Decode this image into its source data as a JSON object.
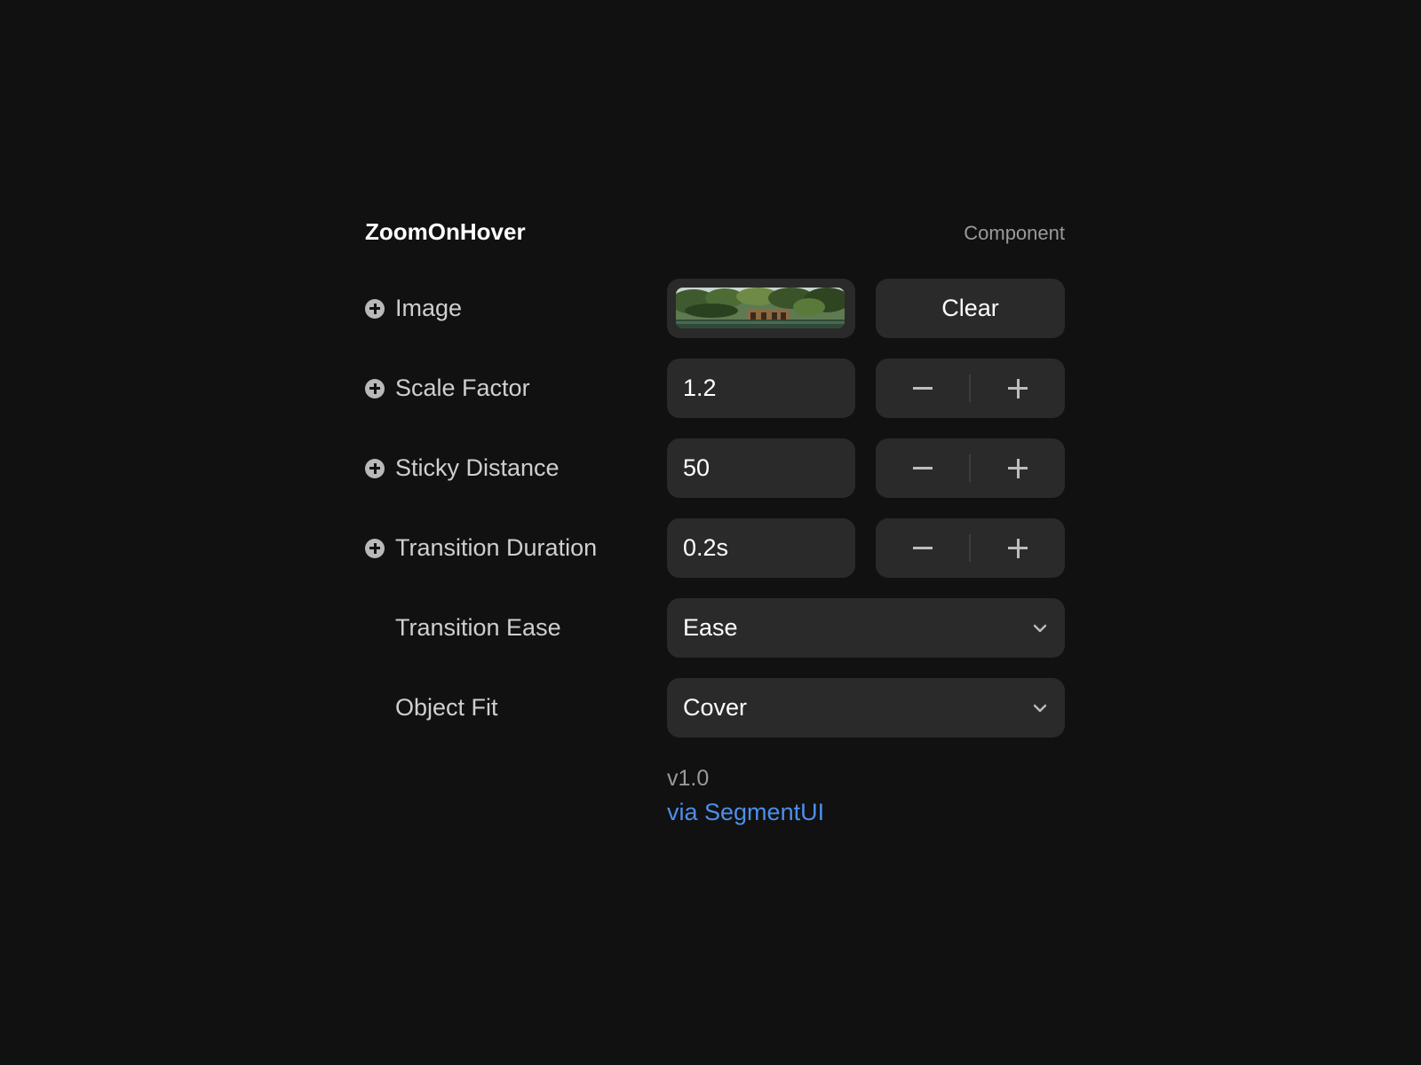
{
  "header": {
    "title": "ZoomOnHover",
    "kind": "Component"
  },
  "properties": {
    "image": {
      "label": "Image",
      "clear_label": "Clear"
    },
    "scale_factor": {
      "label": "Scale Factor",
      "value": "1.2"
    },
    "sticky_distance": {
      "label": "Sticky Distance",
      "value": "50"
    },
    "transition_duration": {
      "label": "Transition Duration",
      "value": "0.2s"
    },
    "transition_ease": {
      "label": "Transition Ease",
      "value": "Ease"
    },
    "object_fit": {
      "label": "Object Fit",
      "value": "Cover"
    }
  },
  "footer": {
    "version": "v1.0",
    "link": "via SegmentUI"
  },
  "icons": {
    "add": "plus-circle-icon",
    "decrement": "minus-icon",
    "increment": "plus-icon",
    "dropdown": "chevron-down-icon"
  },
  "colors": {
    "background": "#111111",
    "control": "#2a2a2a",
    "link": "#4d8fea"
  }
}
